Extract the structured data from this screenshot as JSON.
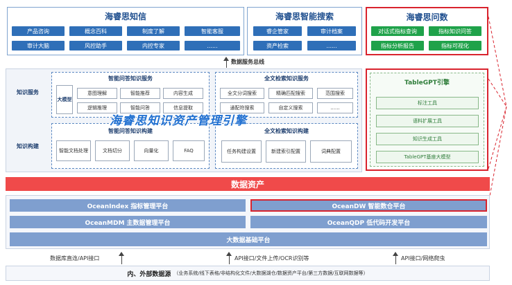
{
  "top": {
    "zhixin": {
      "title": "海睿思知信",
      "buttons": [
        "产品咨询",
        "概念百科",
        "制度了解",
        "智能客服",
        "审计大脑",
        "风控助手",
        "内控专家",
        "......"
      ]
    },
    "search": {
      "title": "海睿思智能搜索",
      "buttons": [
        "睿企管家",
        "审计档案",
        "资产检索",
        "......"
      ]
    },
    "wenshu": {
      "title": "海睿思问数",
      "buttons": [
        "对话式指标查询",
        "指标知识问答",
        "指标分析报告",
        "指标可视化"
      ]
    }
  },
  "data_service_label": "数据服务总线",
  "engine": {
    "rows": {
      "service": "知识服务",
      "build": "知识构建"
    },
    "qa_service": {
      "title": "智能问答知识服务",
      "big_model": "大模型",
      "items": [
        "意图理解",
        "智能推荐",
        "内容生成",
        "逻辑推理",
        "智能问答",
        "信息提取"
      ]
    },
    "search_service": {
      "title": "全文检索知识服务",
      "items": [
        "全文分词搜索",
        "精确匹配搜索",
        "范围搜索",
        "通配符搜索",
        "自定义搜索",
        "......"
      ]
    },
    "overlay_title": "海睿思知识资产管理引擎",
    "qa_build": {
      "title": "智能问答知识构建",
      "items": [
        "智能文档处理",
        "文档切分",
        "向量化",
        "FAQ"
      ]
    },
    "search_build": {
      "title": "全文检索知识构建",
      "items": [
        "任务构建设置",
        "新建索引配置",
        "词典配置"
      ]
    },
    "tablegpt": {
      "title": "TableGPT引擎",
      "items": [
        "标注工具",
        "语料扩展工具",
        "知识生成工具",
        "TableGPT基座大模型"
      ]
    }
  },
  "data_assets": "数据资产",
  "platforms": {
    "ocean_index": "OceanIndex 指标管理平台",
    "ocean_dw": "OceanDW 智能数仓平台",
    "ocean_mdm": "OceanMDM 主数据管理平台",
    "ocean_qdp": "OceanQDP 低代码开发平台",
    "bigdata": "大数据基础平台"
  },
  "ingest": {
    "left": "数据库直连/API接口",
    "middle": "API接口/文件上传/OCR识别等",
    "right": "API接口/网络爬虫"
  },
  "sources": {
    "title": "内、外部数据源",
    "detail": "（业务系统/线下表格/非结构化文件/大数据湖仓/数据资产平台/第三方数据/互联网数据等）"
  },
  "colors": {
    "blue_button": "#2f6fb8",
    "green_button": "#1fa24a",
    "data_asset_bar": "#f04a4a",
    "platform": "#7f9fcf",
    "highlight_border": "#d9232d",
    "title_blue": "#1f4f8f"
  }
}
